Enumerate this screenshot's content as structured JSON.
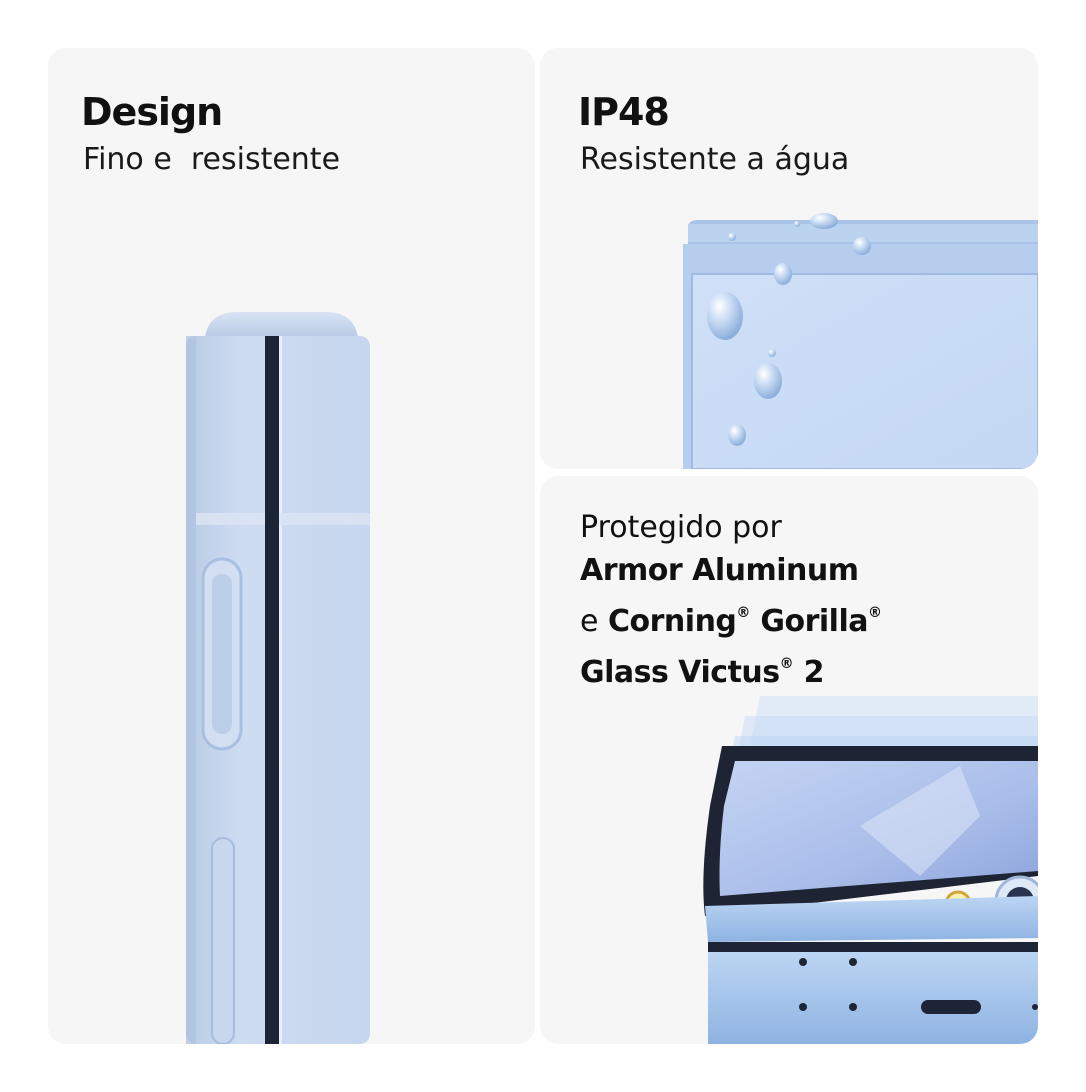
{
  "panels": {
    "design": {
      "title": "Design",
      "subtitle": "Fino e  resistente"
    },
    "ip48": {
      "title": "IP48",
      "subtitle": "Resistente a água"
    },
    "armor": {
      "line1": "Protegido por",
      "line2_bold": "Armor Aluminum",
      "line3_prefix": "e ",
      "line3_bold_a": "Corning",
      "line3_sup_a": "®",
      "line3_bold_b": " Gorilla",
      "line3_sup_b": "®",
      "line4_bold_a": "Glass Victus",
      "line4_sup": "®",
      "line4_bold_b": " 2"
    }
  },
  "colors": {
    "panel_background": "#f6f6f6",
    "phone_blue": "#c5d6ef",
    "phone_blue_dark": "#8fb0dc",
    "hinge_dark": "#1c2536",
    "text": "#111111"
  },
  "images": {
    "design": "folded-phone-side-view-image",
    "ip48": "water-drops-on-phone-image",
    "armor": "phone-glass-layers-image"
  }
}
